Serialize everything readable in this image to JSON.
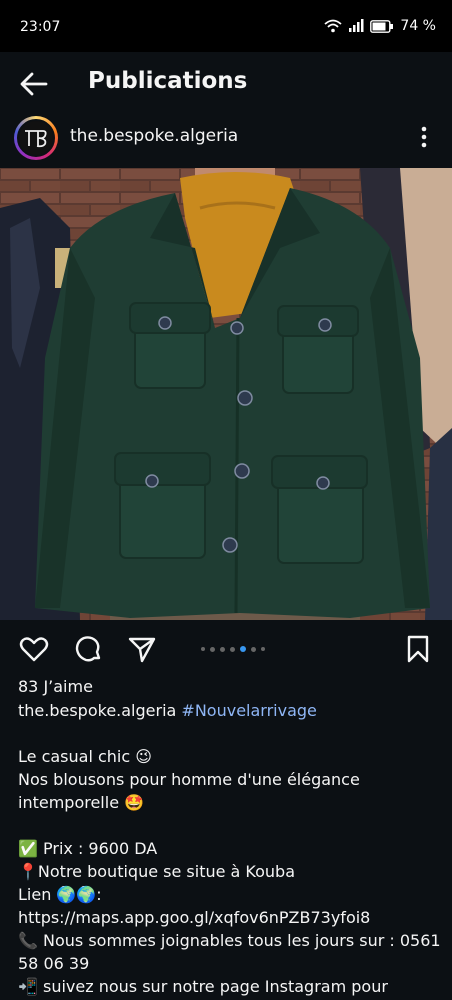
{
  "status_bar": {
    "time": "23:07",
    "battery": "74 %"
  },
  "header": {
    "title": "Publications"
  },
  "post": {
    "username": "the.bespoke.algeria",
    "likes": "83 J’aime",
    "caption_user": "the.bespoke.algeria",
    "caption_hashtag": "#Nouvelarrivage",
    "caption_lines": [
      "Le casual chic 😉",
      "Nos blousons pour homme d'une élégance",
      "intemporelle 🤩",
      "",
      "✅ Prix :  9600 DA",
      "📍Notre boutique se situe à Kouba",
      "Lien 🌍🌍:",
      "https://maps.app.goo.gl/xqfov6nPZB73yfoi8",
      "📞 Nous sommes joignables tous les jours sur : 0561",
      "58 06 39",
      "📲 suivez nous sur notre page Instagram pour"
    ],
    "carousel": {
      "count": 7,
      "active_index": 4
    }
  },
  "colors": {
    "background": "#0c1014",
    "accent_dot": "#3897f0",
    "hashtag": "#8fb6f5",
    "jacket": "#1f3d33",
    "sweater": "#c98a1e"
  },
  "icons": [
    "back-arrow-icon",
    "more-vertical-icon",
    "heart-icon",
    "comment-icon",
    "share-icon",
    "bookmark-icon",
    "wifi-icon",
    "signal-icon",
    "battery-icon"
  ]
}
